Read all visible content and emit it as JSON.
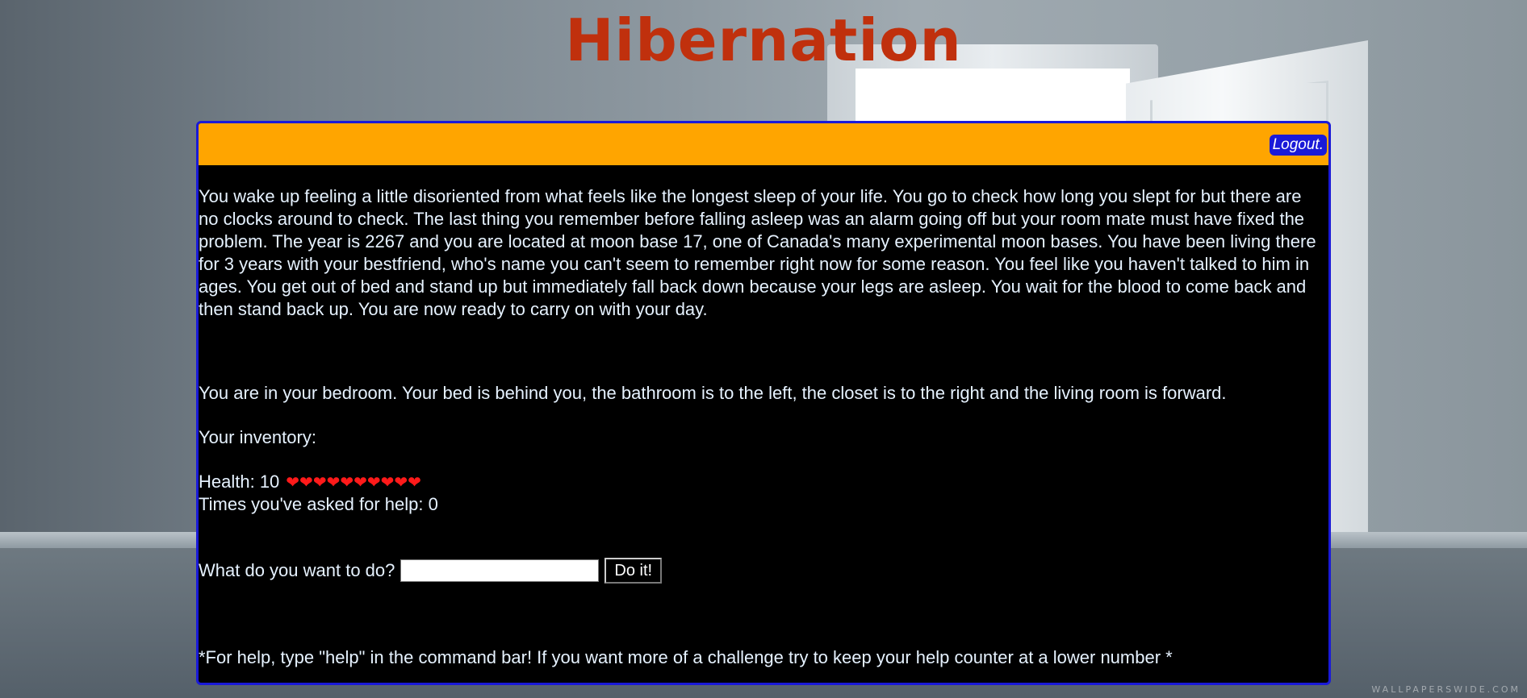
{
  "title": "Hibernation",
  "header": {
    "logout_label": "Logout."
  },
  "story": "You wake up feeling a little disoriented from what feels like the longest sleep of your life. You go to check how long you slept for but there are no clocks around to check. The last thing you remember before falling asleep was an alarm going off but your room mate must have fixed the problem. The year is 2267 and you are located at moon base 17, one of Canada's many experimental moon bases. You have been living there for 3 years with your bestfriend, who's name you can't seem to remember right now for some reason. You feel like you haven't talked to him in ages. You get out of bed and stand up but immediately fall back down because your legs are asleep. You wait for the blood to come back and then stand back up. You are now ready to carry on with your day.",
  "location": "You are in your bedroom. Your bed is behind you, the bathroom is to the left, the closet is to the right and the living room is forward.",
  "inventory_label": "Your inventory:",
  "health": {
    "label": "Health: 10",
    "value": 10,
    "hearts": "❤❤❤❤❤❤❤❤❤❤"
  },
  "help_counter_label": "Times you've asked for help: 0",
  "command": {
    "prompt": "What do you want to do?",
    "value": "",
    "button_label": "Do it!"
  },
  "help_note": "*For help, type \"help\" in the command bar! If you want more of a challenge try to keep your help counter at a lower number *",
  "watermark": "WALLPAPERSWIDE.COM",
  "colors": {
    "title": "#c0300d",
    "header_bar": "#ffa500",
    "panel_border": "#1a1ad8",
    "panel_bg": "#000000",
    "text": "#e6f2ff",
    "hearts": "#ff1a1a"
  }
}
